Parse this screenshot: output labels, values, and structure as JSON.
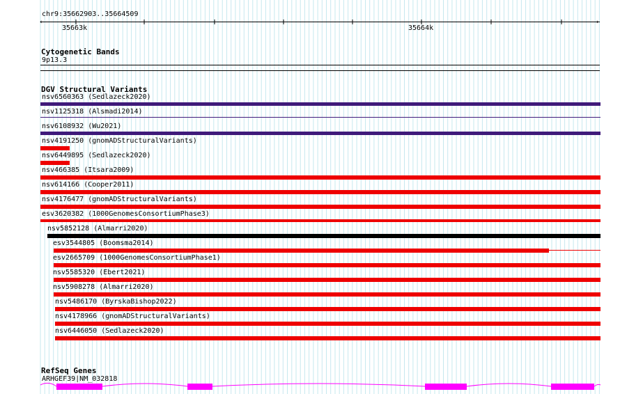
{
  "ruler": {
    "region": "chr9:35662903..35664509",
    "ticks": [
      "35663k",
      "35664k"
    ]
  },
  "tracks": {
    "cytoband": {
      "title": "Cytogenetic Bands",
      "band": "9p13.3"
    },
    "dgv": {
      "title": "DGV Structural Variants",
      "features": [
        {
          "id": "nsv6560363",
          "source": "Sedlazeck2020",
          "color": "#3f1a7a"
        },
        {
          "id": "nsv1125318",
          "source": "Alsmadi2014",
          "color": "#3f1a7a"
        },
        {
          "id": "nsv6108932",
          "source": "Wu2021",
          "color": "#3f1a7a"
        },
        {
          "id": "nsv4191250",
          "source": "gnomADStructuralVariants",
          "color": "#ee0000"
        },
        {
          "id": "nsv6449895",
          "source": "Sedlazeck2020",
          "color": "#ee0000"
        },
        {
          "id": "nsv466385",
          "source": "Itsara2009",
          "color": "#ee0000"
        },
        {
          "id": "nsv614166",
          "source": "Cooper2011",
          "color": "#ee0000"
        },
        {
          "id": "nsv4176477",
          "source": "gnomADStructuralVariants",
          "color": "#ee0000"
        },
        {
          "id": "esv3620382",
          "source": "1000GenomesConsortiumPhase3",
          "color": "#ee0000"
        },
        {
          "id": "nsv5852128",
          "source": "Almarri2020",
          "color": "#000000"
        },
        {
          "id": "esv3544805",
          "source": "Boomsma2014",
          "color": "#ee0000"
        },
        {
          "id": "esv2665709",
          "source": "1000GenomesConsortiumPhase1",
          "color": "#ee0000"
        },
        {
          "id": "nsv5585320",
          "source": "Ebert2021",
          "color": "#ee0000"
        },
        {
          "id": "nsv5908278",
          "source": "Almarri2020",
          "color": "#ee0000"
        },
        {
          "id": "nsv5486170",
          "source": "ByrskaBishop2022",
          "color": "#ee0000"
        },
        {
          "id": "nsv4178966",
          "source": "gnomADStructuralVariants",
          "color": "#ee0000"
        },
        {
          "id": "nsv6446050",
          "source": "Sedlazeck2020",
          "color": "#ee0000"
        }
      ]
    },
    "refseq": {
      "title": "RefSeq Genes",
      "gene": "ARHGEF39|NM_032818",
      "color": "#ff00ff"
    }
  }
}
